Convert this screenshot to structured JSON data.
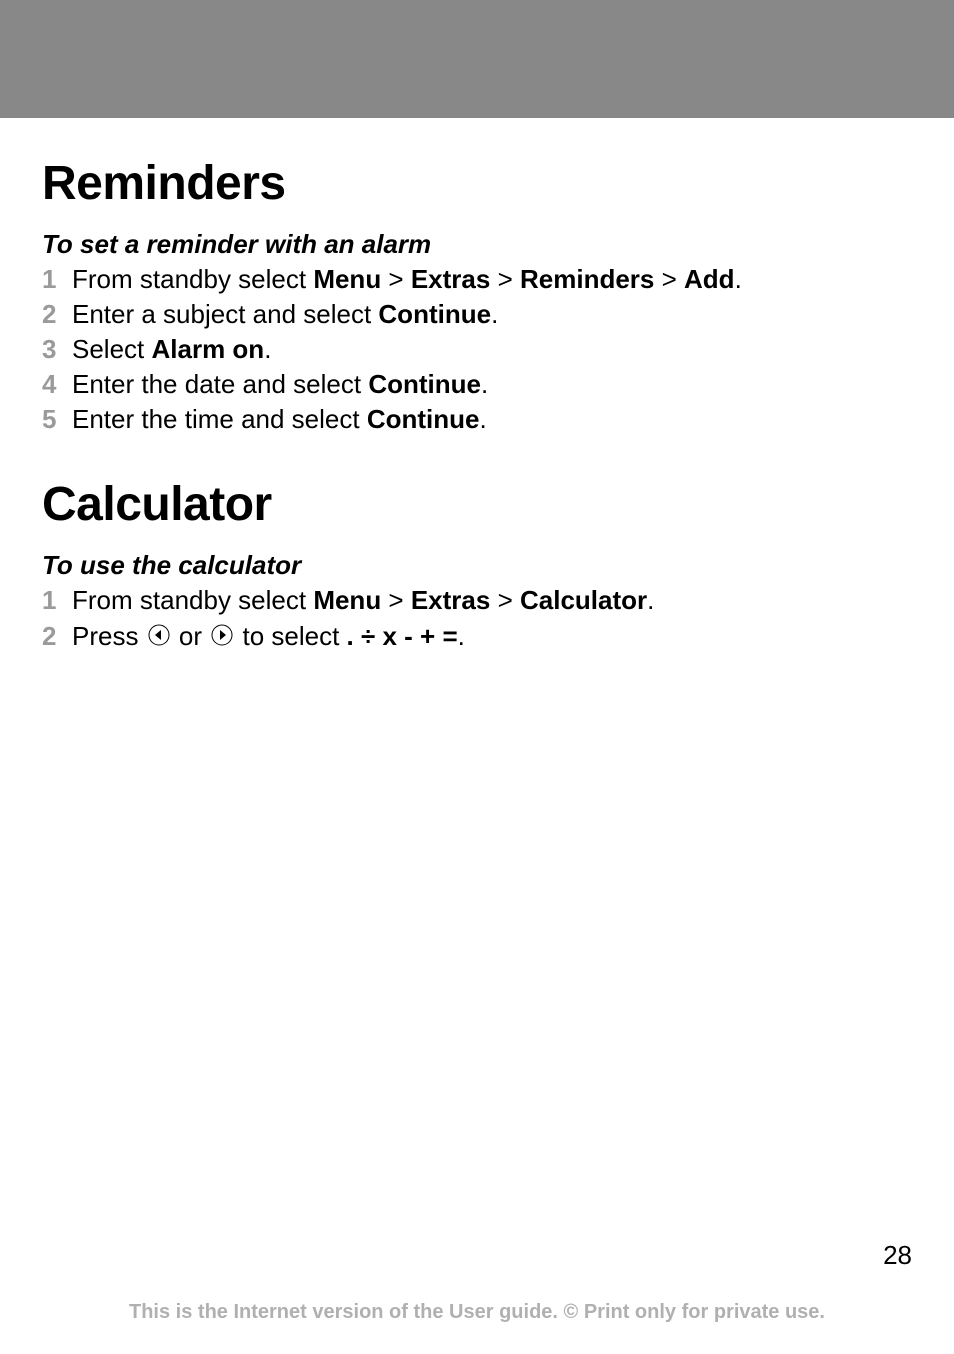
{
  "section1": {
    "heading": "Reminders",
    "subheading": "To set a reminder with an alarm",
    "steps": [
      {
        "num": "1",
        "parts": [
          "From standby select ",
          "Menu",
          " > ",
          "Extras",
          " > ",
          "Reminders",
          " > ",
          "Add",
          "."
        ]
      },
      {
        "num": "2",
        "parts": [
          "Enter a subject and select ",
          "Continue",
          "."
        ]
      },
      {
        "num": "3",
        "parts": [
          "Select ",
          "Alarm on",
          "."
        ]
      },
      {
        "num": "4",
        "parts": [
          "Enter the date and select ",
          "Continue",
          "."
        ]
      },
      {
        "num": "5",
        "parts": [
          "Enter the time and select ",
          "Continue",
          "."
        ]
      }
    ]
  },
  "section2": {
    "heading": "Calculator",
    "subheading": "To use the calculator",
    "steps": [
      {
        "num": "1",
        "parts": [
          "From standby select ",
          "Menu",
          " > ",
          "Extras",
          " > ",
          "Calculator",
          "."
        ]
      },
      {
        "num": "2",
        "parts_pre": "Press ",
        "parts_mid": " or ",
        "parts_post": " to select ",
        "symbols": ". ÷ x - + =",
        "end": "."
      }
    ]
  },
  "pageNumber": "28",
  "footer": "This is the Internet version of the User guide. © Print only for private use."
}
